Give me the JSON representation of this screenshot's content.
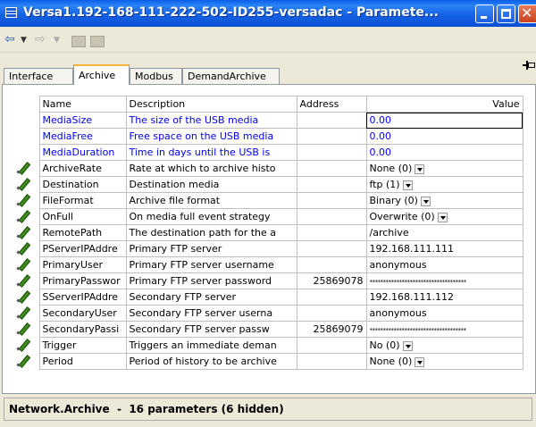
{
  "window": {
    "title": "Versa1.192-168-111-222-502-ID255-versadac - Paramete...",
    "accent": "#0a5fe8"
  },
  "toolbar": {
    "icons": [
      "back-arrow-icon",
      "dropdown-arrow-icon",
      "forward-arrow-icon",
      "dropdown-arrow-icon",
      "folder-icon",
      "folder-icon",
      "pin-icon"
    ]
  },
  "tabs": [
    {
      "label": "Interface"
    },
    {
      "label": "Archive",
      "active": true
    },
    {
      "label": "Modbus"
    },
    {
      "label": "DemandArchive"
    }
  ],
  "grid": {
    "headers": {
      "name": "Name",
      "description": "Description",
      "address": "Address",
      "value": "Value"
    },
    "rows": [
      {
        "name": "MediaSize",
        "description": "The size of the USB media",
        "address": "",
        "value": "0.00",
        "editable": false,
        "blue": true,
        "focused": true
      },
      {
        "name": "MediaFree",
        "description": "Free space on the USB media",
        "address": "",
        "value": "0.00",
        "editable": false,
        "blue": true
      },
      {
        "name": "MediaDuration",
        "description": "Time in days until the USB is",
        "address": "",
        "value": "0.00",
        "editable": false,
        "blue": true
      },
      {
        "name": "ArchiveRate",
        "description": "Rate at which to archive histo",
        "address": "",
        "value": "None (0)",
        "editable": true,
        "dropdown": true
      },
      {
        "name": "Destination",
        "description": "Destination media",
        "address": "",
        "value": "ftp (1)",
        "editable": true,
        "dropdown": true
      },
      {
        "name": "FileFormat",
        "description": "Archive file format",
        "address": "",
        "value": "Binary (0)",
        "editable": true,
        "dropdown": true
      },
      {
        "name": "OnFull",
        "description": "On media full event strategy",
        "address": "",
        "value": "Overwrite (0)",
        "editable": true,
        "dropdown": true
      },
      {
        "name": "RemotePath",
        "description": "The destination path for the a",
        "address": "",
        "value": "/archive",
        "editable": true
      },
      {
        "name": "PServerIPAddre",
        "description": "Primary FTP server",
        "address": "",
        "value": "192.168.111.111",
        "editable": true
      },
      {
        "name": "PrimaryUser",
        "description": "Primary FTP server username",
        "address": "",
        "value": "anonymous",
        "editable": true
      },
      {
        "name": "PrimaryPasswor",
        "description": "Primary FTP server password",
        "address": "25869078",
        "value": "************************************",
        "editable": true
      },
      {
        "name": "SServerIPAddre",
        "description": "Secondary FTP server",
        "address": "",
        "value": "192.168.111.112",
        "editable": true
      },
      {
        "name": "SecondaryUser",
        "description": "Secondary FTP server userna",
        "address": "",
        "value": "anonymous",
        "editable": true
      },
      {
        "name": "SecondaryPassi",
        "description": "Secondary FTP server passw",
        "address": "25869079",
        "value": "************************************",
        "editable": true
      },
      {
        "name": "Trigger",
        "description": "Triggers an immediate deman",
        "address": "",
        "value": "No (0)",
        "editable": true,
        "dropdown": true
      },
      {
        "name": "Period",
        "description": "Period of history to be archive",
        "address": "",
        "value": "None (0)",
        "editable": true,
        "dropdown": true
      }
    ]
  },
  "status": {
    "text": "Network.Archive  -  16 parameters (6 hidden)"
  }
}
